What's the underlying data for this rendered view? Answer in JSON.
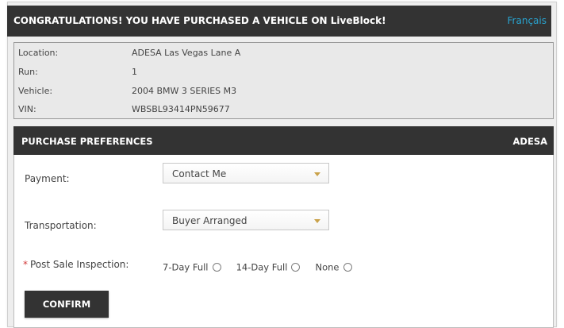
{
  "header": {
    "title": "CONGRATULATIONS! YOU HAVE PURCHASED A VEHICLE ON LiveBlock!",
    "language_link": "Français",
    "language_link_color": "#29a3cf"
  },
  "vehicle_info": {
    "rows": [
      {
        "label": "Location:",
        "value": "ADESA Las Vegas Lane A"
      },
      {
        "label": "Run:",
        "value": "1"
      },
      {
        "label": "Vehicle:",
        "value": "2004 BMW 3 SERIES M3"
      },
      {
        "label": "VIN:",
        "value": "WBSBL93414PN59677"
      }
    ]
  },
  "preferences": {
    "title": "PURCHASE PREFERENCES",
    "brand": "ADESA",
    "payment": {
      "label": "Payment:",
      "selected": "Contact Me"
    },
    "transportation": {
      "label": "Transportation:",
      "selected": "Buyer Arranged"
    },
    "inspection": {
      "required_marker": "*",
      "label": "Post Sale Inspection:",
      "options": [
        "7-Day Full",
        "14-Day Full",
        "None"
      ]
    },
    "confirm_label": "CONFIRM"
  },
  "colors": {
    "dark_bar": "#333333",
    "required_marker": "#d23a3a",
    "dropdown_arrow": "#c9a24a"
  }
}
